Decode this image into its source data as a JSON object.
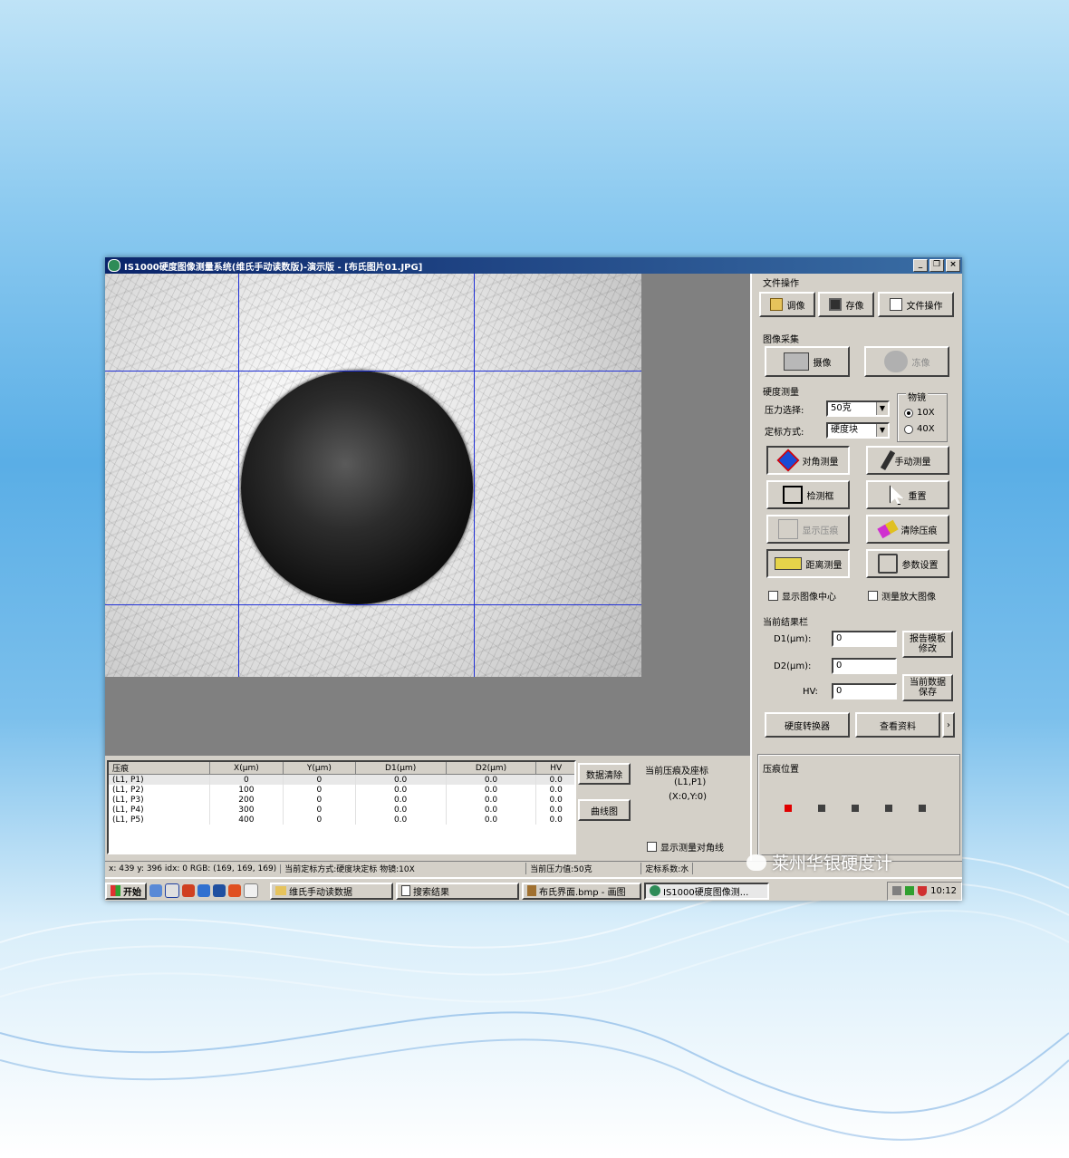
{
  "window": {
    "title": "IS1000硬度图像测量系统(维氏手动读数版)-演示版 - [布氏图片01.JPG]",
    "min_icon": "minimize-icon",
    "max_icon": "maximize-icon",
    "close_label": "×"
  },
  "file_ops": {
    "label": "文件操作",
    "load": "调像",
    "save": "存像",
    "file": "文件操作"
  },
  "capture": {
    "label": "图像采集",
    "grab": "摄像",
    "freeze": "冻像"
  },
  "hardness": {
    "label": "硬度测量",
    "force_label": "压力选择:",
    "force_value": "50克",
    "calib_label": "定标方式:",
    "calib_value": "硬度块",
    "objective_label": "物镜",
    "obj_10x": "10X",
    "obj_40x": "40X",
    "diag_measure": "对角测量",
    "manual_measure": "手动测量",
    "detect_box": "检测框",
    "reset": "重置",
    "show_indent": "显示压痕",
    "clear_indent": "清除压痕",
    "distance_measure": "距离测量",
    "param_settings": "参数设置",
    "show_center": "显示图像中心",
    "measure_zoom": "测量放大图像"
  },
  "results": {
    "label": "当前结果栏",
    "d1_label": "D1(μm):",
    "d1_value": "0",
    "d2_label": "D2(μm):",
    "d2_value": "0",
    "hv_label": "HV:",
    "hv_value": "0",
    "report_btn_1": "报告模板",
    "report_btn_2": "修改",
    "save_btn_1": "当前数据",
    "save_btn_2": "保存",
    "converter": "硬度转换器",
    "view_docs": "查看资料",
    "more": "›"
  },
  "indent_pos": {
    "label": "压痕位置"
  },
  "table": {
    "headers": [
      "压痕",
      "X(μm)",
      "Y(μm)",
      "D1(μm)",
      "D2(μm)",
      "HV"
    ],
    "rows": [
      [
        "(L1, P1)",
        "0",
        "0",
        "0.0",
        "0.0",
        "0.0"
      ],
      [
        "(L1, P2)",
        "100",
        "0",
        "0.0",
        "0.0",
        "0.0"
      ],
      [
        "(L1, P3)",
        "200",
        "0",
        "0.0",
        "0.0",
        "0.0"
      ],
      [
        "(L1, P4)",
        "300",
        "0",
        "0.0",
        "0.0",
        "0.0"
      ],
      [
        "(L1, P5)",
        "400",
        "0",
        "0.0",
        "0.0",
        "0.0"
      ]
    ]
  },
  "mid": {
    "clear_data": "数据清除",
    "curve": "曲线图",
    "current_label": "当前压痕及座标",
    "current_id": "(L1,P1)",
    "current_xy": "(X:0,Y:0)",
    "show_diag": "显示测量对角线"
  },
  "status": {
    "coords": "x: 439 y: 396  idx: 0  RGB: (169, 169, 169)",
    "calib": "当前定标方式:硬度块定标  物镜:10X",
    "force": "当前压力值:50克",
    "coef": "定标系数:水"
  },
  "taskbar": {
    "start": "开始",
    "task1": "维氏手动读数据",
    "task2": "搜索结果",
    "task3": "布氏界面.bmp - 画图",
    "task4": "IS1000硬度图像测...",
    "time": "10:12"
  },
  "watermark": "莱州华银硬度计",
  "colors": {
    "title_start": "#0a246a",
    "title_end": "#3a6ea5",
    "guide": "#1f2fd6",
    "active_pos": "#e00000",
    "inactive_pos": "#404040"
  }
}
